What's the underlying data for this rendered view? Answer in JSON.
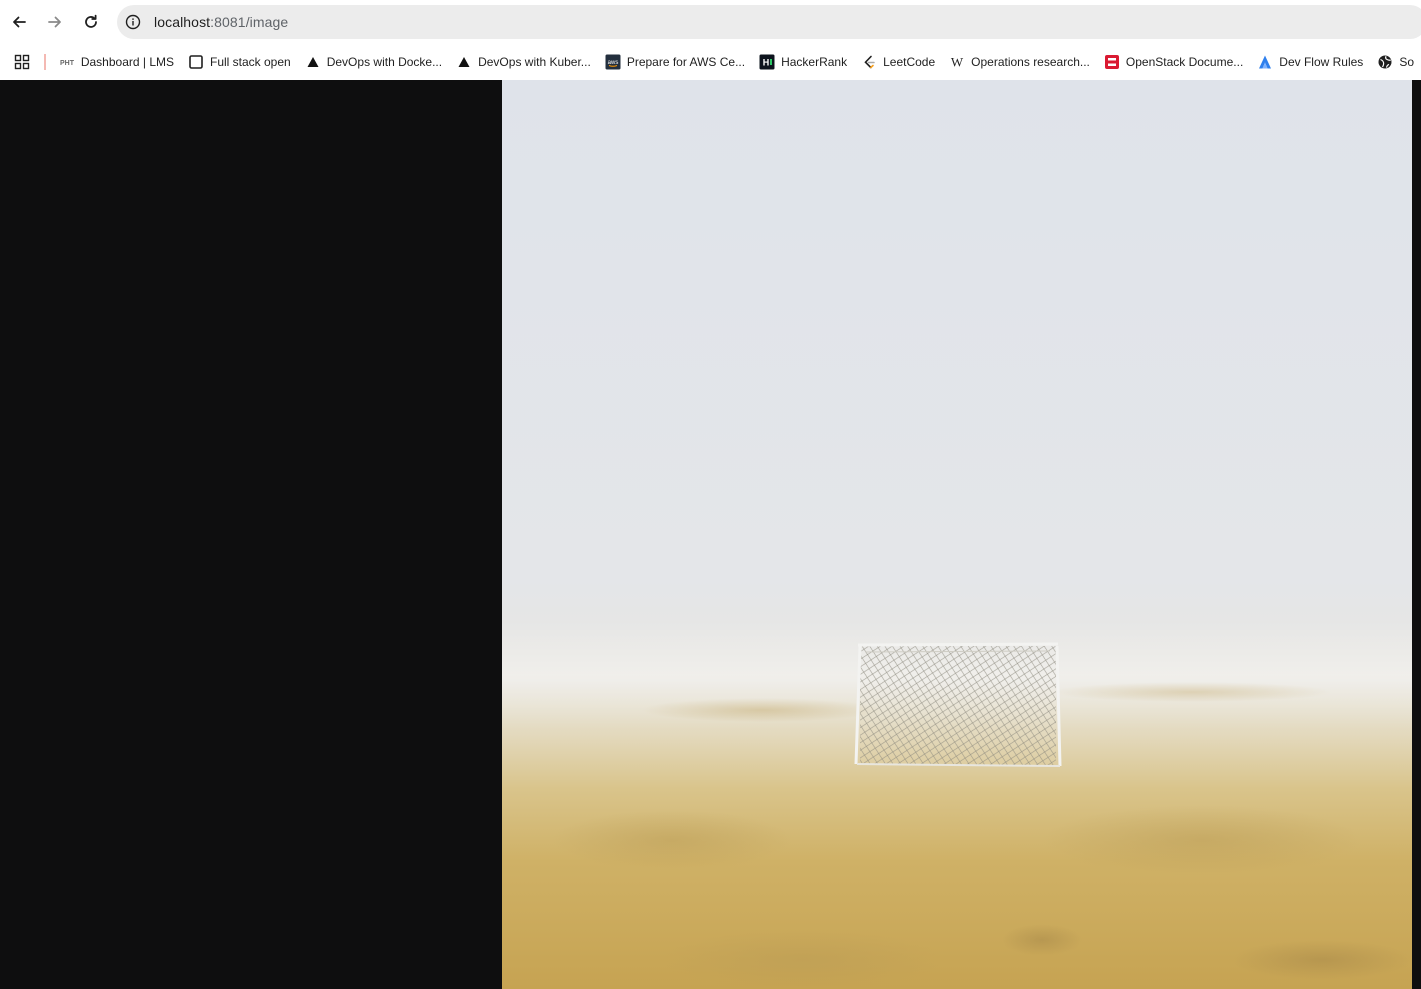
{
  "browser": {
    "url_host": "localhost",
    "url_rest": ":8081/image"
  },
  "bookmarks": [
    {
      "label": "Dashboard | LMS",
      "icon": "pht-logo-icon"
    },
    {
      "label": "Full stack open",
      "icon": "square-outline-icon"
    },
    {
      "label": "DevOps with Docke...",
      "icon": "triangle-icon"
    },
    {
      "label": "DevOps with Kuber...",
      "icon": "triangle-icon"
    },
    {
      "label": "Prepare for AWS Ce...",
      "icon": "aws-logo-icon"
    },
    {
      "label": "HackerRank",
      "icon": "hackerrank-logo-icon"
    },
    {
      "label": "LeetCode",
      "icon": "leetcode-logo-icon"
    },
    {
      "label": "Operations research...",
      "icon": "wikipedia-icon"
    },
    {
      "label": "OpenStack Docume...",
      "icon": "openstack-logo-icon"
    },
    {
      "label": "Dev Flow Rules",
      "icon": "blue-a-logo-icon"
    },
    {
      "label": "So",
      "icon": "globe-icon"
    }
  ],
  "favicon_text": {
    "pht": "PHT",
    "aws": "aws",
    "hackerrank": "H",
    "wikipedia": "W"
  },
  "image": {
    "description_icon": "foggy-field-goal-image"
  },
  "colors": {
    "page_background": "#0e0e0f",
    "sky": "#dfe2e8",
    "grass": "#c9a95c"
  }
}
